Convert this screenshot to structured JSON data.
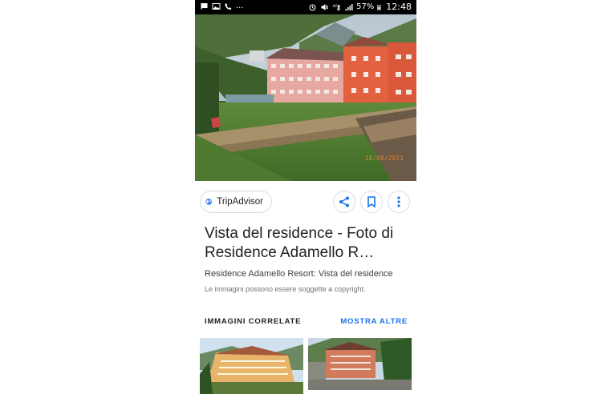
{
  "status_bar": {
    "left_icons": [
      "message-icon",
      "image-icon",
      "call-icon",
      "more-dots"
    ],
    "ellipsis": "...",
    "battery": "57%",
    "time": "12:48"
  },
  "hero": {
    "date_stamp": "18/08/2011"
  },
  "source": {
    "label": "TripAdvisor",
    "icon": "globe-icon"
  },
  "action_icons": [
    "share-icon",
    "bookmark-icon",
    "more-vert-icon"
  ],
  "result": {
    "title": "Vista del residence - Foto di Residence Adamello R…",
    "subtitle": "Residence Adamello Resort: Vista del residence",
    "copyright": "Le immagini possono essere soggette a copyright."
  },
  "related": {
    "heading": "IMMAGINI CORRELATE",
    "more_label": "MOSTRA ALTRE"
  },
  "colors": {
    "accent": "#1a73e8",
    "date_stamp": "#e07b2a"
  }
}
